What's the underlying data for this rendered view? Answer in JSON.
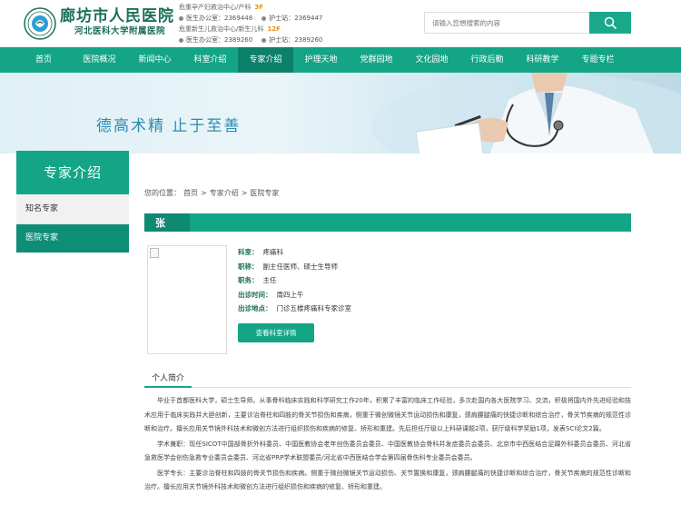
{
  "header": {
    "logo_title": "廊坊市人民医院",
    "logo_subtitle": "河北医科大学附属医院",
    "contacts": [
      {
        "title": "危重孕产妇救治中心/产科",
        "floor": "3F",
        "office_label": "医生办公室：",
        "office_phone": "2369448",
        "nurse_label": "护士站：",
        "nurse_phone": "2369447"
      },
      {
        "title": "危重新生儿救治中心/新生儿科",
        "floor": "12F",
        "office_label": "医生办公室：",
        "office_phone": "2389260",
        "nurse_label": "护士站：",
        "nurse_phone": "2389260"
      }
    ],
    "search_placeholder": "请输入您想搜索的内容"
  },
  "nav": {
    "items": [
      "首页",
      "医院概况",
      "新闻中心",
      "科室介绍",
      "专家介绍",
      "护理天地",
      "党群园地",
      "文化园地",
      "行政后勤",
      "科研教学",
      "专题专栏"
    ],
    "active_index": 4
  },
  "banner": {
    "slogan": "德高术精  止于至善"
  },
  "sidebar": {
    "title": "专家介绍",
    "items": [
      "知名专家",
      "医院专家"
    ]
  },
  "breadcrumb": {
    "prefix": "您的位置：",
    "items": [
      "首页",
      "专家介绍",
      "医院专家"
    ],
    "separator": ">"
  },
  "doctor": {
    "name": "张",
    "fields": [
      {
        "key": "科室：",
        "value": "疼痛科"
      },
      {
        "key": "职称：",
        "value": "副主任医师、硕士生导师"
      },
      {
        "key": "职务：",
        "value": "主任"
      },
      {
        "key": "出诊时间：",
        "value": "周四上午"
      },
      {
        "key": "出诊地点：",
        "value": "门诊五楼疼痛科专家诊室"
      }
    ],
    "button": "查看科室详情"
  },
  "intro": {
    "tab": "个人简介",
    "paragraphs": [
      "毕业于首都医科大学，硕士生导师。从事骨科临床实践和科学研究工作20年，积累了丰富的临床工作经验，多次赴国内各大医院学习、交流，积极将国内外先进经验和技术应用于临床实践并大胆创新，主要诊治脊柱和四肢的骨关节损伤和疾病，侧重于微创微镜关节运动损伤和康复，颈肩腰腿痛的快捷诊断和综合治疗，骨关节疾病的规范性诊断和治疗。擅长应用关节镜外科技术和微创方法进行组织损伤和疾病的修复、矫形和重建。先后担任厅级以上科研课题2项，获厅级科学奖励1项，发表SCI论文2篇。",
      "学术兼职：现任SICOT中国部骨折外科委员、中国医教协会老年创伤委员会委员、中国医教协会骨科并发症委员会委员、北京市中西医结合足踝外科委员会委员、河北省急救医学会创伤急救专业委员会委员、河北省PRP学术联盟委员/河北省中西医结合学会第四届骨伤科专业委员会委员。",
      "医学专长：主要诊治脊柱和四肢的骨关节损伤和疾病。侧重于微创微镜关节运动损伤、关节置换和康复，颈肩腰腿痛的快捷诊断和综合治疗，骨关节疾病的规范性诊断和治疗。擅长应用关节镜外科技术和微创方法进行组织损伤和疾病的修复、矫形和重建。"
    ]
  },
  "colors": {
    "primary": "#13a586",
    "primary_dark": "#0d8069",
    "logo_green": "#1d6f5a",
    "floor_orange": "#e8910c",
    "slogan_blue": "#2d8cae"
  }
}
